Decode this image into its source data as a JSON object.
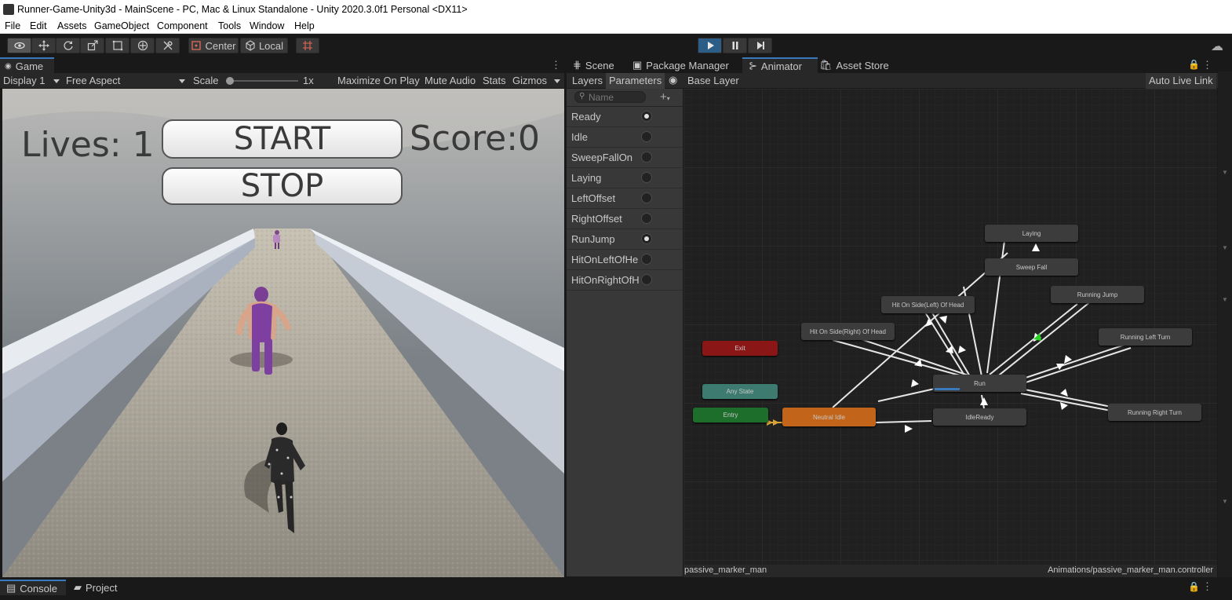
{
  "window": {
    "title": "Runner-Game-Unity3d - MainScene - PC, Mac & Linux Standalone - Unity 2020.3.0f1 Personal <DX11>"
  },
  "menu": [
    "File",
    "Edit",
    "Assets",
    "GameObject",
    "Component",
    "Tools",
    "Window",
    "Help"
  ],
  "toolbar": {
    "center_label": "Center",
    "local_label": "Local"
  },
  "game_panel": {
    "tab_label": "Game",
    "display": "Display 1",
    "aspect": "Free Aspect",
    "scale_label": "Scale",
    "scale_value": "1x",
    "maximize": "Maximize On Play",
    "mute": "Mute Audio",
    "stats": "Stats",
    "gizmos": "Gizmos"
  },
  "game_hud": {
    "lives": "Lives: 1",
    "start": "START",
    "stop": "STOP",
    "score": "Score:0"
  },
  "right_tabs": {
    "scene": "Scene",
    "package_manager": "Package Manager",
    "animator": "Animator",
    "asset_store": "Asset Store"
  },
  "animator": {
    "layers_tab": "Layers",
    "parameters_tab": "Parameters",
    "base_layer": "Base Layer",
    "auto_live_link": "Auto Live Link",
    "search_placeholder": "Name",
    "parameters": [
      {
        "name": "Ready",
        "value": true
      },
      {
        "name": "Idle",
        "value": false
      },
      {
        "name": "SweepFallOn",
        "value": false
      },
      {
        "name": "Laying",
        "value": false
      },
      {
        "name": "LeftOffset",
        "value": false
      },
      {
        "name": "RightOffset",
        "value": false
      },
      {
        "name": "RunJump",
        "value": true
      },
      {
        "name": "HitOnLeftOfHe",
        "value": false
      },
      {
        "name": "HitOnRightOfH",
        "value": false
      }
    ],
    "states": {
      "laying": "Laying",
      "sweep_fall": "Sweep Fall",
      "running_jump": "Running Jump",
      "hit_left": "Hit On Side(Left) Of Head",
      "hit_right": "Hit On Side(Right) Of Head",
      "running_left": "Running Left Turn",
      "exit": "Exit",
      "any_state": "Any State",
      "entry": "Entry",
      "neutral_idle": "Neutral Idle",
      "run": "Run",
      "idle_ready": "IdleReady",
      "running_right": "Running Right Turn"
    },
    "run_progress": 0.28,
    "footer_left": "passive_marker_man",
    "footer_right": "Animations/passive_marker_man.controller"
  },
  "bottom": {
    "console": "Console",
    "project": "Project"
  }
}
